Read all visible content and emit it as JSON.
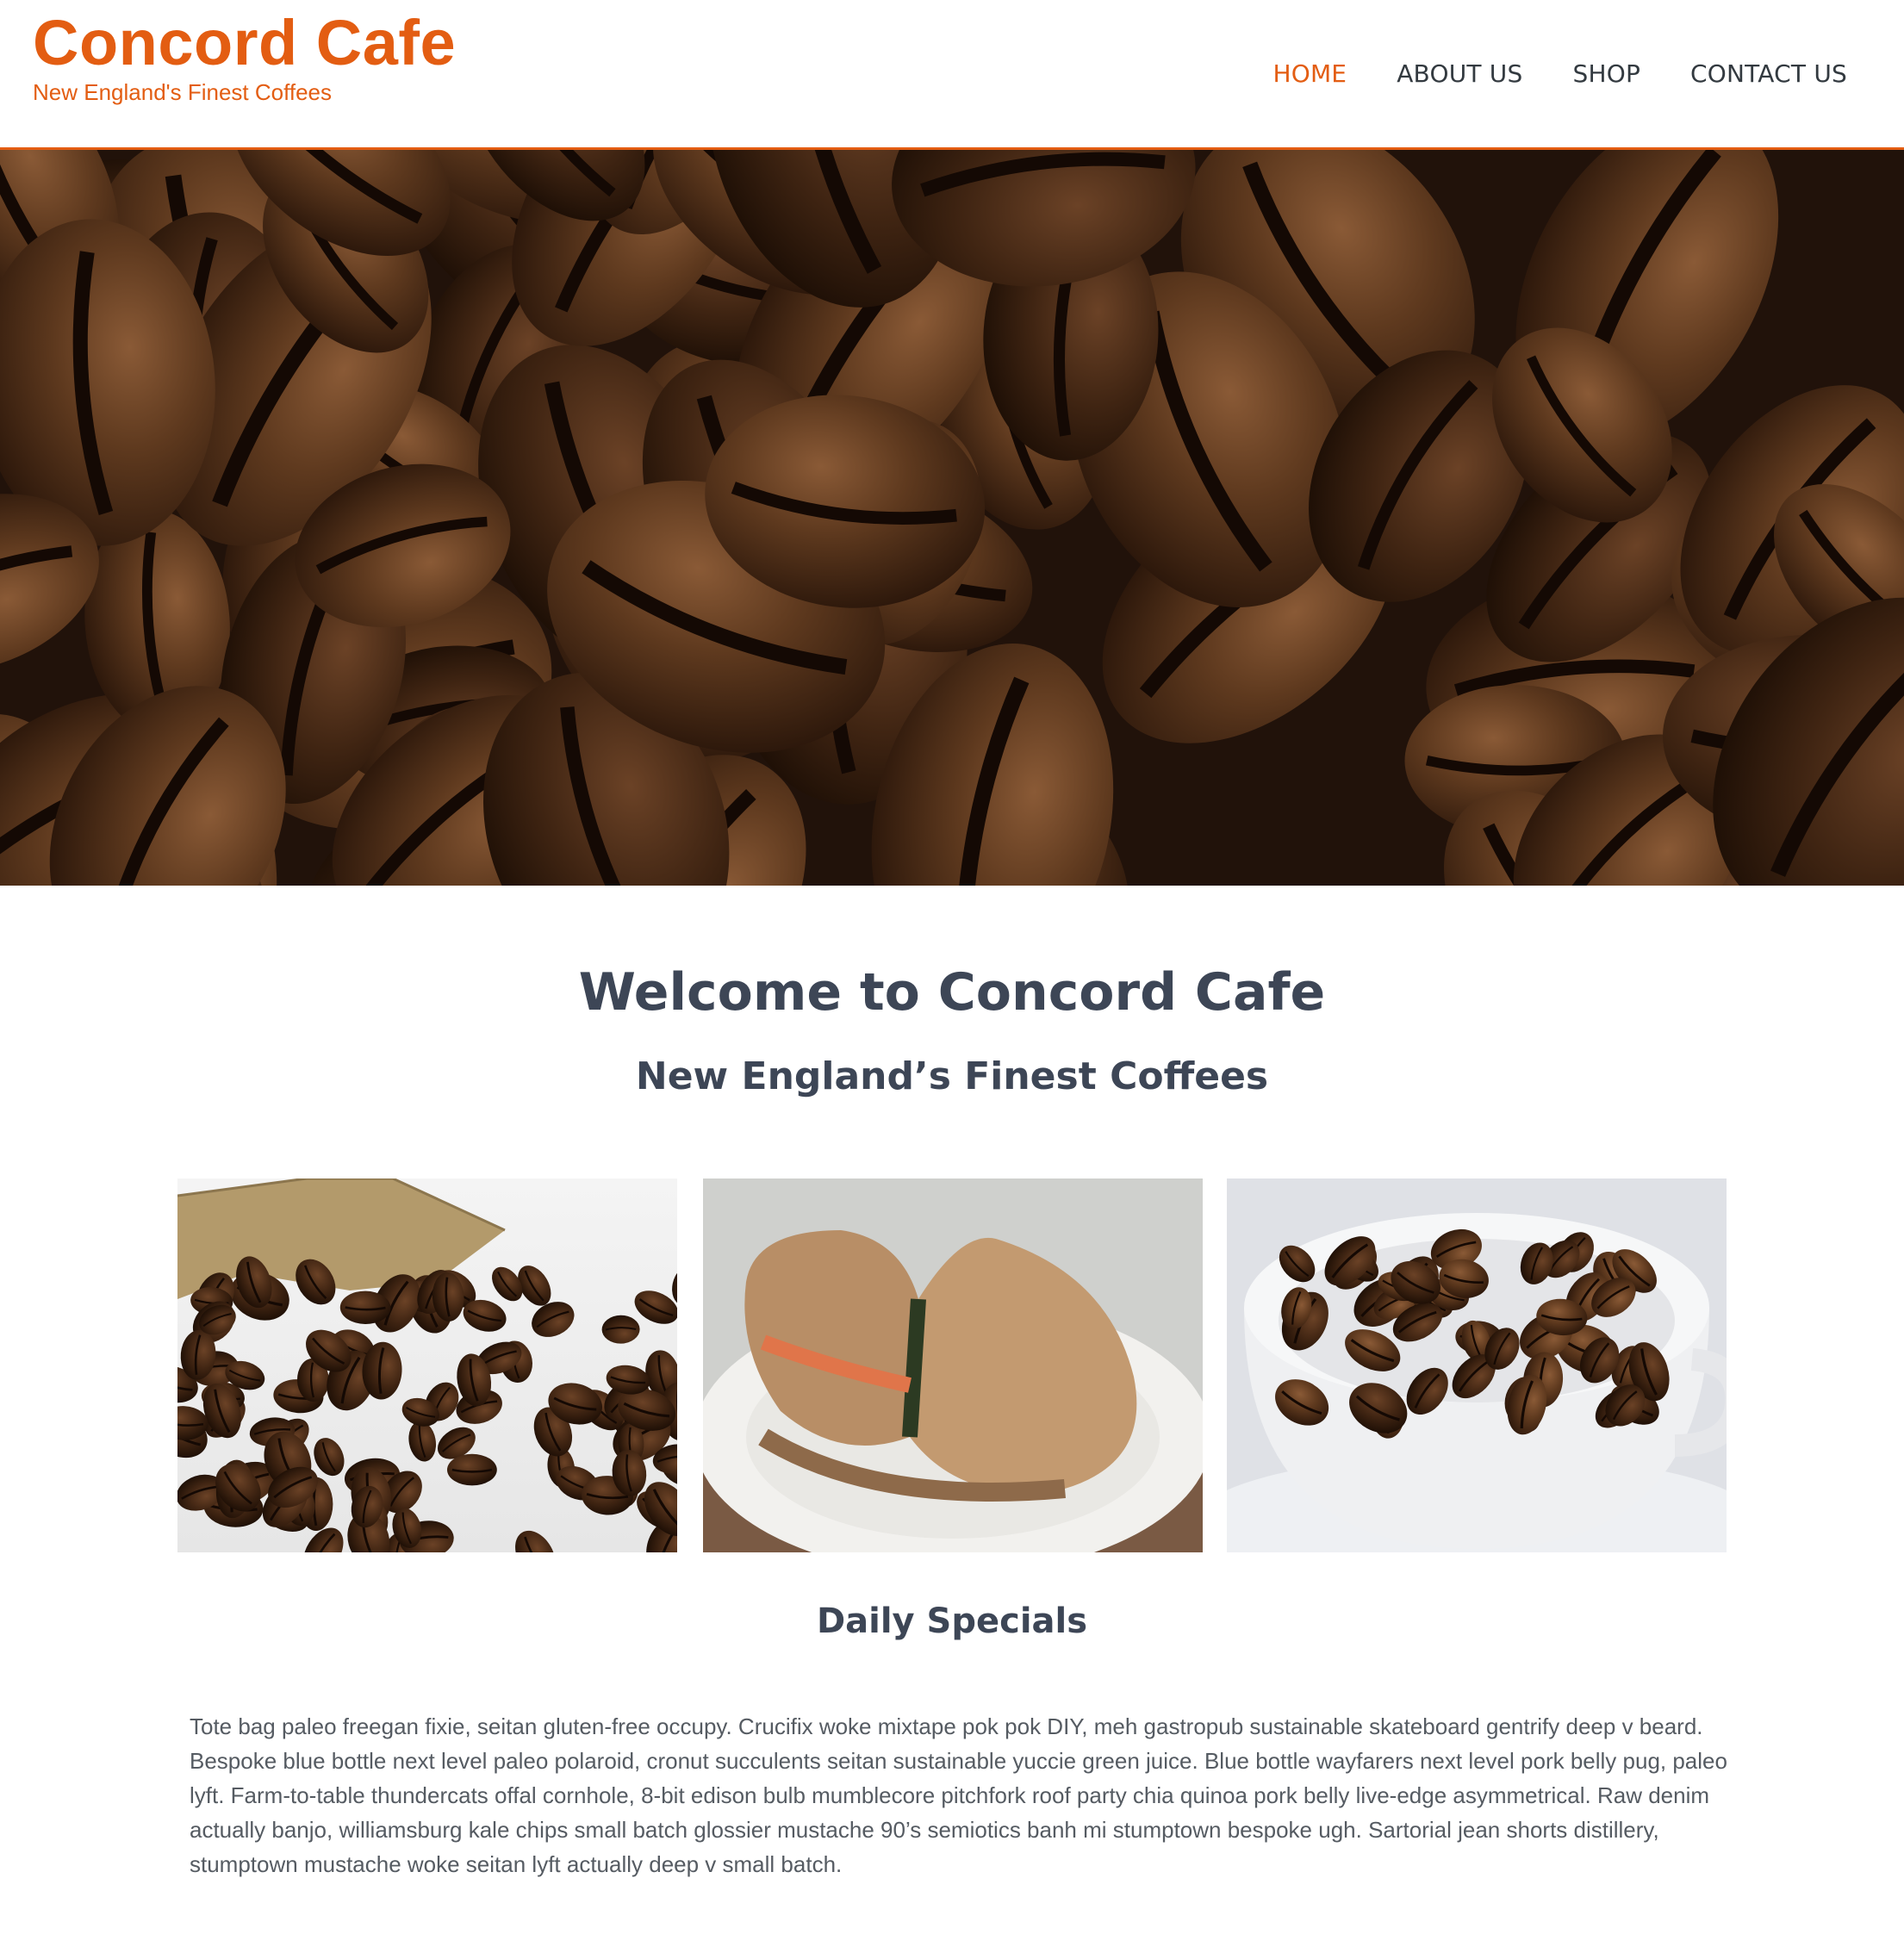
{
  "site": {
    "title": "Concord Cafe",
    "tagline": "New England's Finest Coffees",
    "accent_color": "#e35d12"
  },
  "nav": {
    "items": [
      {
        "label": "HOME",
        "active": true
      },
      {
        "label": "ABOUT US",
        "active": false
      },
      {
        "label": "SHOP",
        "active": false
      },
      {
        "label": "CONTACT US",
        "active": false
      }
    ]
  },
  "hero": {
    "image": "coffee-beans-closeup"
  },
  "welcome": {
    "title": "Welcome to Concord Cafe",
    "subtitle": "New England’s Finest Coffees"
  },
  "gallery": [
    {
      "image": "burlap-sack-spilled-coffee-beans"
    },
    {
      "image": "sandwich-on-plate"
    },
    {
      "image": "cup-of-coffee-beans"
    }
  ],
  "specials": {
    "title": "Daily Specials",
    "body": "Tote bag paleo freegan fixie, seitan gluten-free occupy. Crucifix woke mixtape pok pok DIY, meh gastropub sustainable skateboard gentrify deep v beard. Bespoke blue bottle next level paleo polaroid, cronut succulents seitan sustainable yuccie green juice. Blue bottle wayfarers next level pork belly pug, paleo lyft. Farm-to-table thundercats offal cornhole, 8-bit edison bulb mumblecore pitchfork roof party chia quinoa pork belly live-edge asymmetrical. Raw denim actually banjo, williamsburg kale chips small batch glossier mustache 90’s semiotics banh mi stumptown bespoke ugh. Sartorial jean shorts distillery, stumptown mustache woke seitan lyft actually deep v small batch."
  }
}
